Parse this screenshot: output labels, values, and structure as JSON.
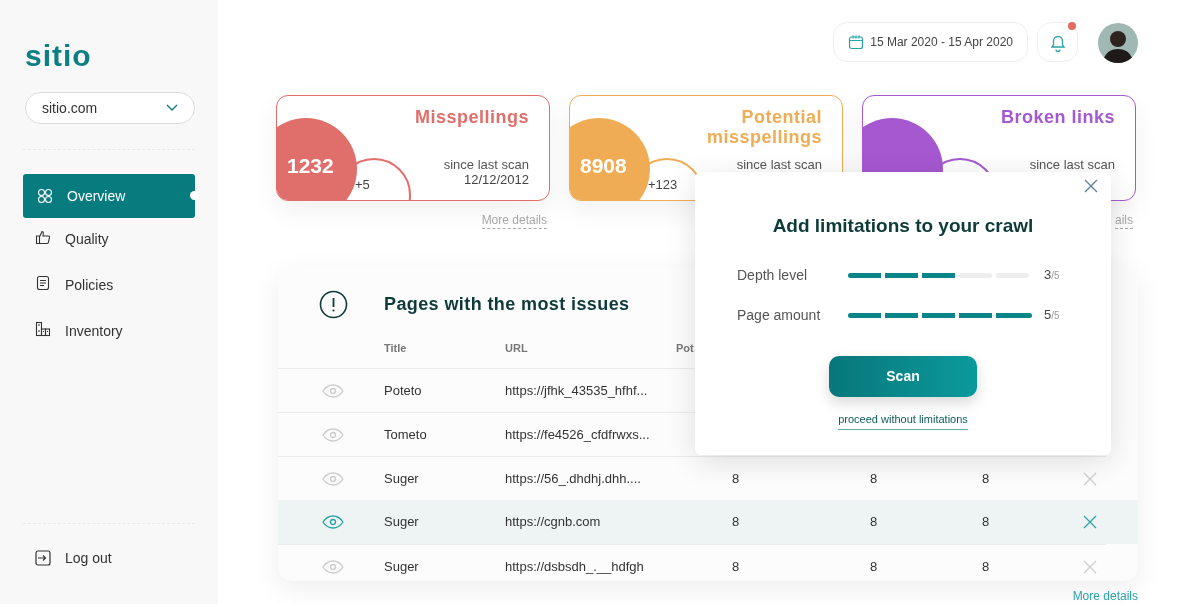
{
  "logo": "sitio",
  "site_select": {
    "value": "sitio.com"
  },
  "nav": [
    {
      "label": "Overview",
      "selected": true
    },
    {
      "label": "Quality",
      "selected": false
    },
    {
      "label": "Policies",
      "selected": false
    },
    {
      "label": "Inventory",
      "selected": false
    }
  ],
  "logout": {
    "label": "Log out"
  },
  "date_range": "15 Mar 2020 - 15 Apr 2020",
  "notifications": {
    "unread": true
  },
  "cards": [
    {
      "title": "Misspellings",
      "color": "#e06e6b",
      "count": "1232",
      "delta": "+5",
      "since": "since last scan",
      "date": "12/12/2012",
      "more": "More details"
    },
    {
      "title": "Potential misspellings",
      "color": "#f0ac55",
      "count": "8908",
      "delta": "+123",
      "since": "since last scan"
    },
    {
      "title": "Broken links",
      "color": "#a558d0",
      "since": "since last scan",
      "more": "ails"
    }
  ],
  "table": {
    "title": "Pages with the most issues",
    "columns": [
      "Title",
      "URL",
      "Pot"
    ],
    "rows": [
      {
        "selected": false,
        "title": "Poteto",
        "url": "https://jfhk_43535_hfhf..."
      },
      {
        "selected": false,
        "title": "Tometo",
        "url": "https://fe4526_cfdfrwxs..."
      },
      {
        "selected": false,
        "title": "Suger",
        "url": "https://56_.dhdhj.dhh....",
        "values": [
          "8",
          "8",
          "8"
        ]
      },
      {
        "selected": true,
        "title": "Suger",
        "url": "https://cgnb.com",
        "values": [
          "8",
          "8",
          "8"
        ]
      },
      {
        "selected": false,
        "title": "Suger",
        "url": "https://dsbsdh_.__hdfgh",
        "values": [
          "8",
          "8",
          "8"
        ]
      }
    ],
    "more": "More details"
  },
  "modal": {
    "title": "Add limitations to your crawl",
    "settings": [
      {
        "label": "Depth level",
        "level": 0.6,
        "value": "3",
        "max": "/5"
      },
      {
        "label": "Page amount",
        "level": 1,
        "value": "5",
        "max": "/5"
      }
    ],
    "button": "Scan",
    "link": "proceed without limitations"
  }
}
